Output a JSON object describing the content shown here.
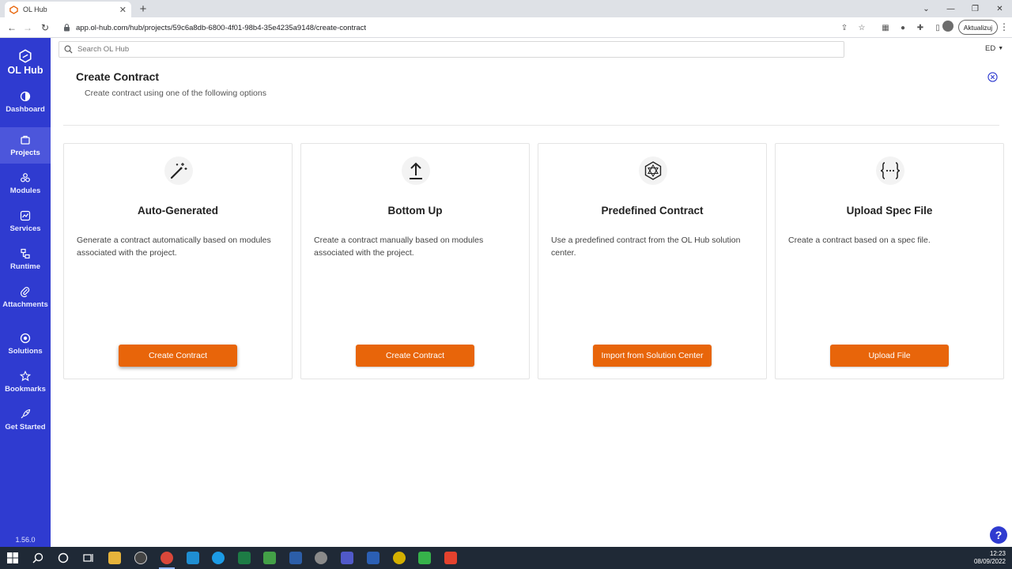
{
  "browser": {
    "tab_title": "OL Hub",
    "url": "app.ol-hub.com/hub/projects/59c6a8db-6800-4f01-98b4-35e4235a9148/create-contract",
    "update_label": "Aktualizuj"
  },
  "app": {
    "brand": "OL Hub",
    "version": "1.56.0",
    "search_placeholder": "Search OL Hub",
    "user_initials": "ED"
  },
  "sidebar": {
    "items": [
      {
        "label": "Dashboard"
      },
      {
        "label": "Projects"
      },
      {
        "label": "Modules"
      },
      {
        "label": "Services"
      },
      {
        "label": "Runtime"
      },
      {
        "label": "Attachments"
      },
      {
        "label": "Solutions"
      },
      {
        "label": "Bookmarks"
      },
      {
        "label": "Get Started"
      }
    ],
    "active": "Projects"
  },
  "page": {
    "title": "Create Contract",
    "subtitle": "Create contract using one of the following options"
  },
  "cards": [
    {
      "title": "Auto-Generated",
      "description": "Generate a contract automatically based on modules associated with the project.",
      "button": "Create Contract",
      "icon": "magic-wand-icon"
    },
    {
      "title": "Bottom Up",
      "description": "Create a contract manually based on modules associated with the project.",
      "button": "Create Contract",
      "icon": "upload-arrow-icon"
    },
    {
      "title": "Predefined Contract",
      "description": "Use a predefined contract from the OL Hub solution center.",
      "button": "Import from Solution Center",
      "icon": "polyhedron-icon"
    },
    {
      "title": "Upload Spec File",
      "description": "Create a contract based on a spec file.",
      "button": "Upload File",
      "icon": "braces-icon"
    }
  ],
  "taskbar": {
    "time": "12:23",
    "date": "08/09/2022"
  },
  "colors": {
    "sidebar": "#2f3bd0",
    "accent": "#e8650a"
  }
}
